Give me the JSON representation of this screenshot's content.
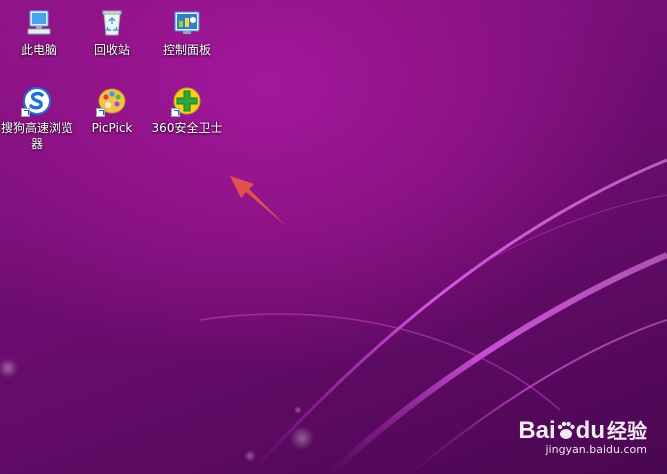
{
  "desktop": {
    "icons": [
      {
        "label": "此电脑",
        "icon": "computer-icon"
      },
      {
        "label": "回收站",
        "icon": "recycle-bin-icon"
      },
      {
        "label": "控制面板",
        "icon": "control-panel-icon"
      },
      {
        "label": "搜狗高速浏览器",
        "icon": "sogou-browser-icon"
      },
      {
        "label": "PicPick",
        "icon": "picpick-icon"
      },
      {
        "label": "360安全卫士",
        "icon": "360-safe-icon"
      }
    ],
    "annotation": {
      "icon": "red-arrow-annotation"
    }
  },
  "watermark": {
    "logo_text_1": "Bai",
    "logo_text_2": "du",
    "logo_text_3": "经验",
    "url": "jingyan.baidu.com"
  },
  "colors": {
    "wallpaper_base": "#6d0d70",
    "wallpaper_highlight": "#a2189c",
    "arrow": "#e0524a"
  }
}
